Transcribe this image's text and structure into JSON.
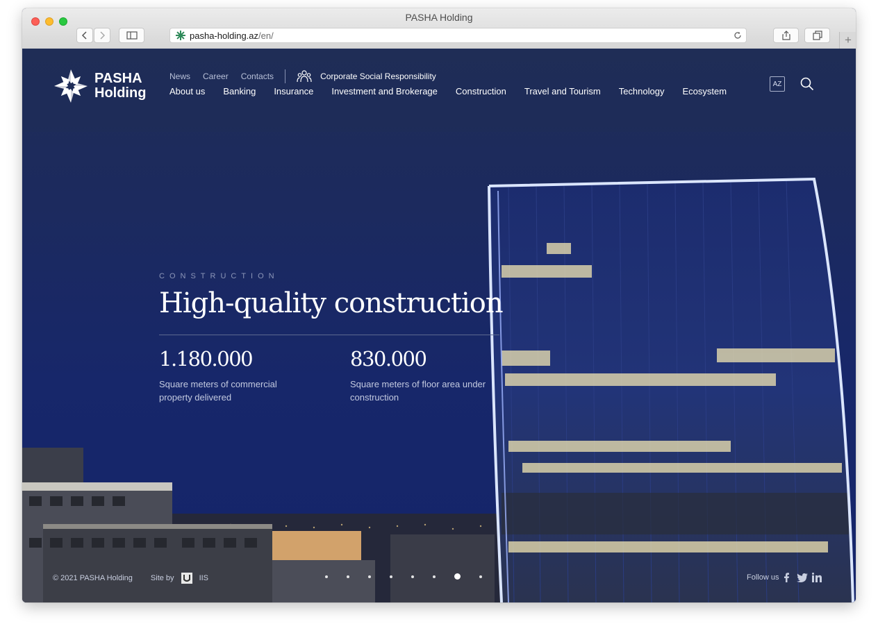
{
  "browser": {
    "window_title": "PASHA Holding",
    "url_host": "pasha-holding.az",
    "url_path": "/en/",
    "new_tab_glyph": "+"
  },
  "site": {
    "logo_line1": "PASHA",
    "logo_line2": "Holding",
    "top_links": [
      "News",
      "Career",
      "Contacts"
    ],
    "csr_label": "Corporate Social Responsibility",
    "main_nav": [
      "About us",
      "Banking",
      "Insurance",
      "Investment and Brokerage",
      "Construction",
      "Travel and Tourism",
      "Technology",
      "Ecosystem"
    ],
    "lang_button": "AZ"
  },
  "hero": {
    "kicker": "CONSTRUCTION",
    "headline": "High-quality construction",
    "stats": [
      {
        "value": "1.180.000",
        "label": "Square meters of commercial property delivered"
      },
      {
        "value": "830.000",
        "label": "Square meters of floor area under construction"
      }
    ],
    "slides_total": 8,
    "active_slide": 7
  },
  "footer": {
    "copyright": "© 2021 PASHA Holding",
    "site_by": "Site by",
    "agency": "IIS",
    "follow": "Follow us",
    "social_icons": [
      "facebook-icon",
      "twitter-icon",
      "linkedin-icon"
    ]
  },
  "colors": {
    "site_background": "#1c2a5e",
    "tower_outline": "#cfe0ff",
    "favicon": "#2f8a5a"
  }
}
